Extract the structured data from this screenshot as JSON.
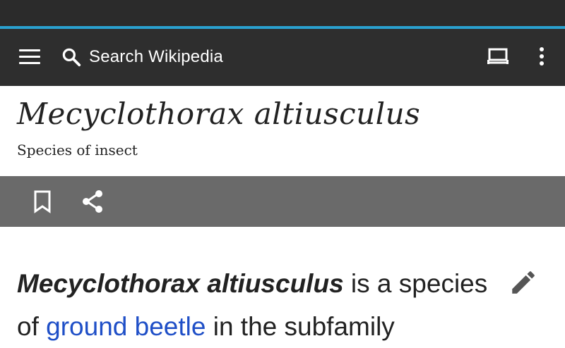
{
  "toolbar": {
    "search_placeholder": "Search Wikipedia"
  },
  "article": {
    "title": "Mecyclothorax altiusculus",
    "description": "Species of insect",
    "lead": {
      "bold_term": "Mecyclothorax altiusculus",
      "text_1": " is a species of ",
      "link_1": "ground beetle",
      "text_2": " in the subfamily"
    }
  },
  "icons": {
    "menu": "menu-icon",
    "search": "search-icon",
    "tabs": "tabs-icon",
    "overflow": "overflow-menu-icon",
    "bookmark": "bookmark-icon",
    "share": "share-icon",
    "edit": "edit-pencil-icon"
  },
  "colors": {
    "toolbar_bg": "#2e2e2e",
    "progress": "#2aa1cf",
    "action_bar_bg": "#6a6a6a",
    "link": "#1f4fc7"
  }
}
